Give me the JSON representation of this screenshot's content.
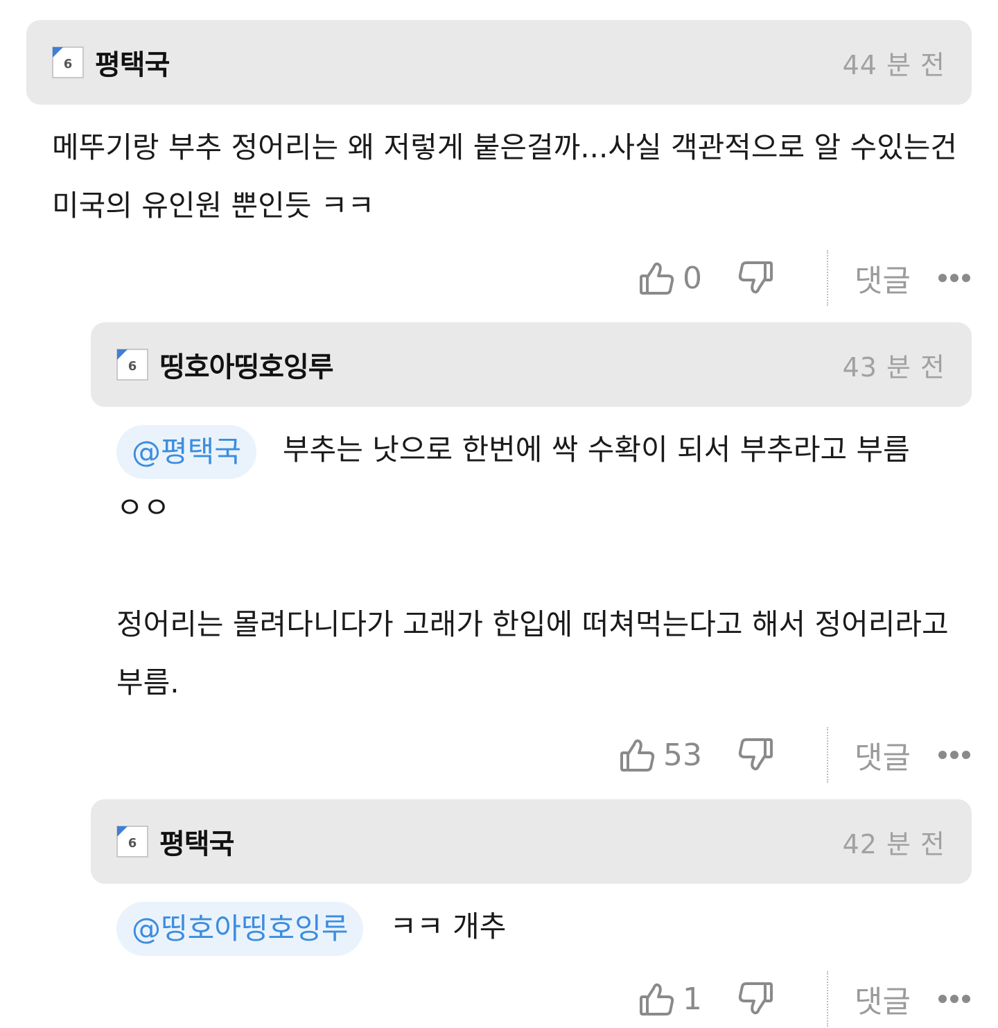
{
  "comments": [
    {
      "nickname": "평택국",
      "time": "44 분 전",
      "mention": "",
      "paragraphs": [
        "메뚜기랑 부추 정어리는 왜 저렇게 붙은걸까...사실 객관적으로 알 수있는건 미국의 유인원 뿐인듯 ㅋㅋ"
      ],
      "likes": "0",
      "reply_label": "댓글"
    },
    {
      "nickname": "띵호아띵호잉루",
      "time": "43 분 전",
      "mention": "@평택국",
      "paragraphs": [
        "부추는 낫으로 한번에 싹 수확이 되서 부추라고 부름 ㅇㅇ",
        "정어리는 몰려다니다가 고래가 한입에 떠쳐먹는다고 해서 정어리라고 부름."
      ],
      "likes": "53",
      "reply_label": "댓글"
    },
    {
      "nickname": "평택국",
      "time": "42 분 전",
      "mention": "@띵호아띵호잉루",
      "paragraphs": [
        "ㅋㅋ 개추"
      ],
      "likes": "1",
      "reply_label": "댓글"
    }
  ],
  "icons": {
    "level": "level-6-badge-icon",
    "like": "thumbs-up-icon",
    "dislike": "thumbs-down-icon",
    "more": "more-dots-icon"
  },
  "level_badge_text": "6",
  "colors": {
    "header_bg": "#e9e9e9",
    "mention_text": "#3c8dde",
    "mention_bg": "#eaf3fc"
  }
}
